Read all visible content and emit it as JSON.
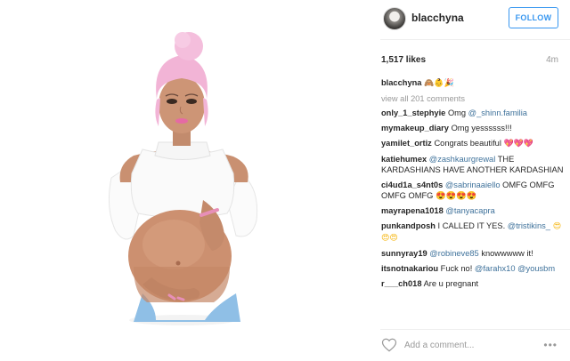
{
  "header": {
    "username": "blacchyna",
    "follow_label": "FOLLOW"
  },
  "stats": {
    "likes": "1,517 likes",
    "time": "4m"
  },
  "caption": {
    "username": "blacchyna",
    "emoji": "🙈👶🎉"
  },
  "view_all": "view all 201 comments",
  "comments": [
    {
      "user": "only_1_stephyie",
      "text": "Omg ",
      "mention": "@_shinn.familia",
      "tail": ""
    },
    {
      "user": "mymakeup_diary",
      "text": "Omg yessssss!!!",
      "mention": "",
      "tail": ""
    },
    {
      "user": "yamilet_ortiz",
      "text": "Congrats beautiful ",
      "mention": "",
      "tail": "💖💖💖"
    },
    {
      "user": "katiehumex",
      "text": "",
      "mention": "@zashkaurgrewal",
      "tail": " THE KARDASHIANS HAVE ANOTHER KARDASHIAN"
    },
    {
      "user": "ci4ud1a_s4nt0s",
      "text": "",
      "mention": "@sabrinaaiello",
      "tail": " OMFG OMFG OMFG OMFG 😍😍😍😍"
    },
    {
      "user": "mayrapena1018",
      "text": "",
      "mention": "@tanyacapra",
      "tail": ""
    },
    {
      "user": "punkandposh",
      "text": "I CALLED IT YES. ",
      "mention": "@tristikins_",
      "tail": " 😍😍😍"
    },
    {
      "user": "sunnyray19",
      "text": "",
      "mention": "@robineve85",
      "tail": " knowwwww it!"
    },
    {
      "user": "itsnotnakariou",
      "text": "Fuck no! ",
      "mention": "@farahx10 @yousbm",
      "tail": ""
    },
    {
      "user": "r___ch018",
      "text": "Are u pregnant",
      "mention": "",
      "tail": ""
    }
  ],
  "comment_box": {
    "placeholder": "Add a comment..."
  },
  "icons": {
    "heart": "heart-outline-icon",
    "more": "more-options-icon"
  },
  "colors": {
    "link": "#3f729b",
    "follow": "#3897f0"
  }
}
